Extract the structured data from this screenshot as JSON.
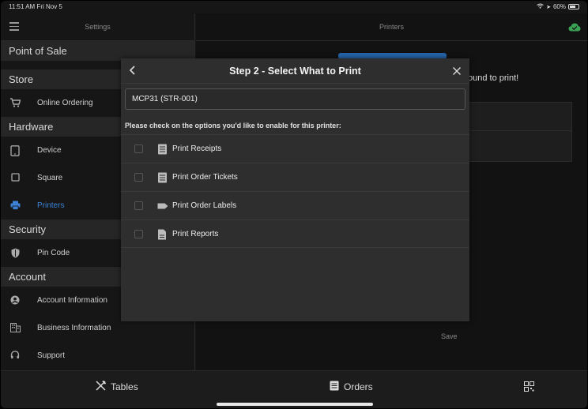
{
  "status_bar": {
    "time_date": "11:51 AM  Fri Nov 5",
    "battery": "60%"
  },
  "sidebar": {
    "header_title": "Settings",
    "sections": [
      {
        "title": "Point of Sale"
      },
      {
        "title": "Store",
        "items": [
          {
            "label": "Online Ordering",
            "icon": "cart-icon"
          }
        ]
      },
      {
        "title": "Hardware",
        "items": [
          {
            "label": "Device",
            "icon": "tablet-icon"
          },
          {
            "label": "Square",
            "icon": "square-icon"
          },
          {
            "label": "Printers",
            "icon": "printer-icon",
            "active": true
          }
        ]
      },
      {
        "title": "Security",
        "items": [
          {
            "label": "Pin Code",
            "icon": "shield-icon"
          }
        ]
      },
      {
        "title": "Account",
        "items": [
          {
            "label": "Account Information",
            "icon": "account-icon"
          },
          {
            "label": "Business Information",
            "icon": "building-icon"
          },
          {
            "label": "Support",
            "icon": "headset-icon"
          }
        ]
      }
    ]
  },
  "main": {
    "header_title": "Printers",
    "background_text": "ound to print!",
    "save_label": "Save"
  },
  "modal": {
    "title": "Step 2 - Select What to Print",
    "printer_value": "MCP31 (STR-001)",
    "instruction": "Please check on the options you'd like to enable for this printer:",
    "options": [
      {
        "label": "Print Receipts",
        "icon": "receipt-icon",
        "checked": false
      },
      {
        "label": "Print Order Tickets",
        "icon": "ticket-icon",
        "checked": false
      },
      {
        "label": "Print Order Labels",
        "icon": "label-icon",
        "checked": false
      },
      {
        "label": "Print Reports",
        "icon": "report-icon",
        "checked": false
      }
    ]
  },
  "tabbar": {
    "tables_label": "Tables",
    "orders_label": "Orders"
  },
  "colors": {
    "accent": "#3b82d6",
    "cloud": "#3aa055",
    "button_blue": "#2563a8"
  }
}
